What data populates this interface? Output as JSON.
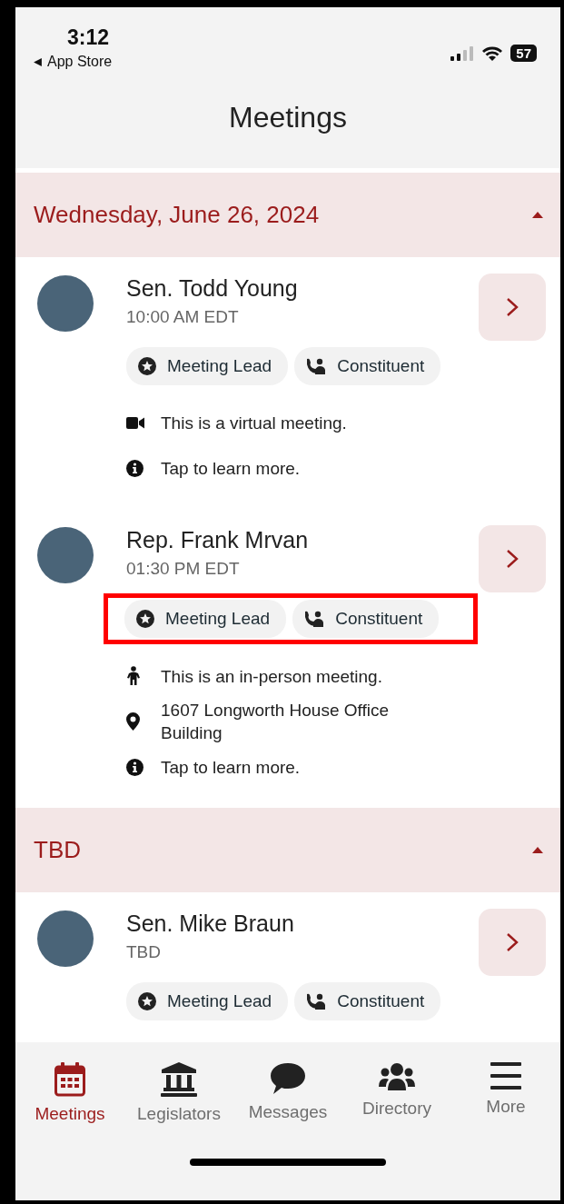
{
  "status_bar": {
    "time": "3:12",
    "back_label": "App Store",
    "battery": "57"
  },
  "title": "Meetings",
  "sections": [
    {
      "heading": "Wednesday, June 26, 2024",
      "expanded": true,
      "meetings": [
        {
          "name": "Sen. Todd Young",
          "time": "10:00 AM EDT",
          "highlighted": false,
          "tags": [
            {
              "kind": "lead",
              "label": "Meeting Lead"
            },
            {
              "kind": "constituent",
              "label": "Constituent"
            }
          ],
          "details": [
            {
              "kind": "video",
              "text": "This is a virtual meeting."
            },
            {
              "kind": "info",
              "text": "Tap to learn more."
            }
          ]
        },
        {
          "name": "Rep. Frank Mrvan",
          "time": "01:30 PM EDT",
          "highlighted": true,
          "tags": [
            {
              "kind": "lead",
              "label": "Meeting Lead"
            },
            {
              "kind": "constituent",
              "label": "Constituent"
            }
          ],
          "details": [
            {
              "kind": "person",
              "text": "This is an in-person meeting."
            },
            {
              "kind": "pin",
              "text": "1607 Longworth House Office Building"
            },
            {
              "kind": "info",
              "text": "Tap to learn more."
            }
          ]
        }
      ]
    },
    {
      "heading": "TBD",
      "expanded": true,
      "meetings": [
        {
          "name": "Sen. Mike Braun",
          "time": "TBD",
          "highlighted": false,
          "tags": [
            {
              "kind": "lead",
              "label": "Meeting Lead"
            },
            {
              "kind": "constituent",
              "label": "Constituent"
            }
          ]
        }
      ]
    }
  ],
  "tabs": [
    {
      "kind": "calendar",
      "label": "Meetings",
      "selected": true
    },
    {
      "kind": "building",
      "label": "Legislators",
      "selected": false
    },
    {
      "kind": "chat",
      "label": "Messages",
      "selected": false
    },
    {
      "kind": "people",
      "label": "Directory",
      "selected": false
    },
    {
      "kind": "menu",
      "label": "More",
      "selected": false
    }
  ]
}
